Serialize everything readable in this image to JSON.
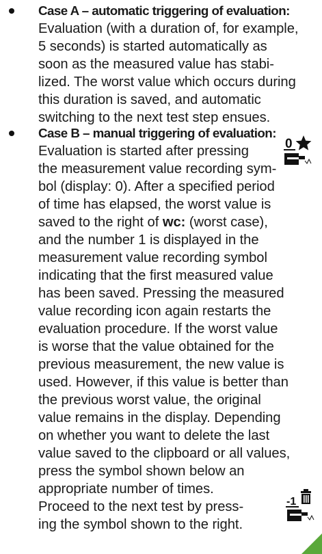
{
  "case_a": {
    "heading": "Case A – automatic triggering of evaluation:",
    "lines": [
      "Evaluation (with a duration of, for example,",
      "5 seconds) is started automatically as",
      "soon as the measured value has stabi-",
      "lized. The worst value which occurs during",
      "this duration is saved, and automatic",
      "switching to the next test step ensues."
    ]
  },
  "case_b": {
    "heading": "Case B – manual triggering of evaluation:",
    "line1": "Evaluation is started after pressing",
    "line2": "the measurement value recording sym-",
    "line3": "bol (display: 0). After a specified period",
    "line4": "of time has elapsed, the worst value is",
    "line5_pre": "saved to the right of ",
    "line5_bold": "wc:",
    "line5_post": " (worst case),",
    "line6": "and the number 1 is displayed in the",
    "line7": "measurement value recording symbol",
    "line8": "indicating that the first measured value",
    "line9": "has been saved. Pressing the measured",
    "line10": "value recording icon again restarts the",
    "line11": "evaluation procedure. If the worst value",
    "line12": "is worse that the value obtained for the",
    "line13": "previous measurement, the new value is",
    "line14": "used. However, if this value is better than",
    "line15": "the previous worst value, the original",
    "line16": "value remains in the display. Depending",
    "line17": "on whether you want to delete the last",
    "line18": "value saved to the clipboard or all values,",
    "line19": "press the symbol shown below an",
    "line20": "appropriate number of times.",
    "line21": "Proceed to the next test by press-",
    "line22": "ing the symbol shown to the right."
  },
  "icons": {
    "record_symbol_digit": "0",
    "delete_symbol_digit": "-1"
  },
  "colors": {
    "text": "#1a1a1a",
    "corner_accent": "#5aa83a"
  }
}
